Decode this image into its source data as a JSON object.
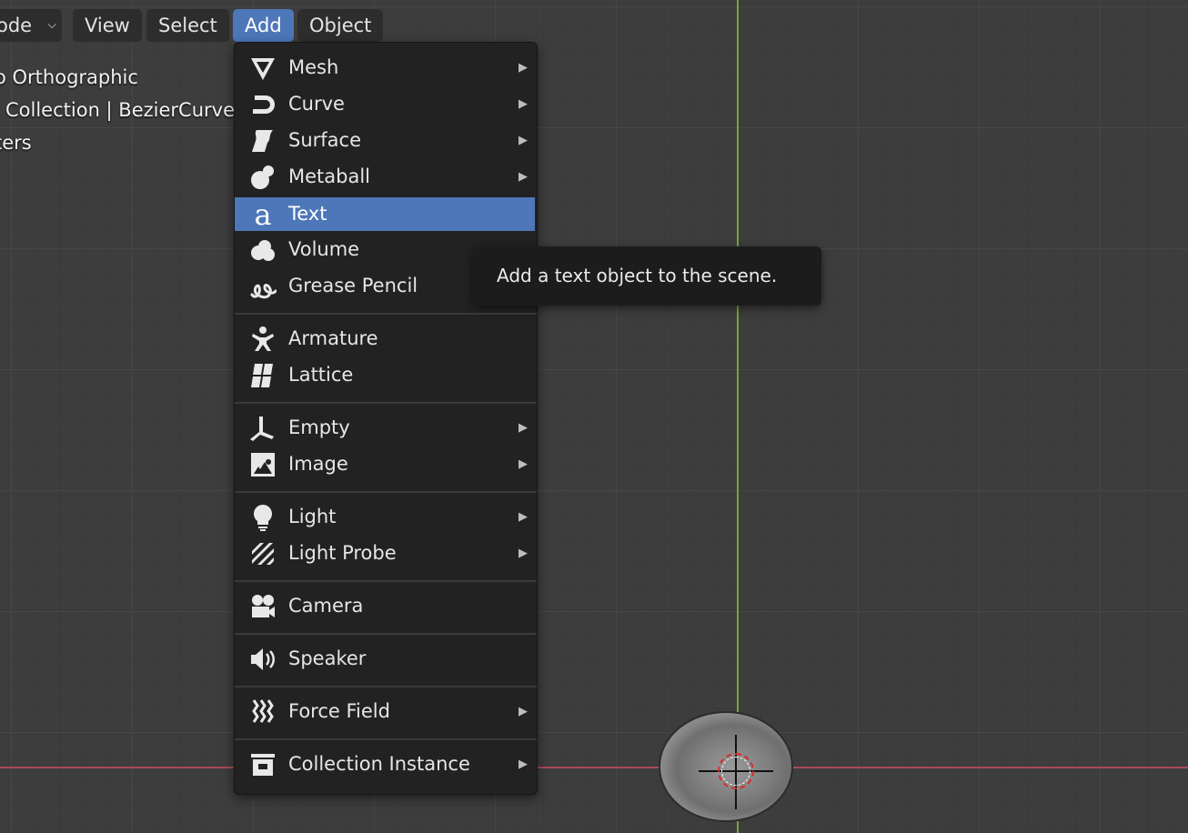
{
  "header": {
    "mode_label": "ode",
    "menus": [
      {
        "label": "View"
      },
      {
        "label": "Select"
      },
      {
        "label": "Add"
      },
      {
        "label": "Object"
      }
    ]
  },
  "overlay": {
    "line1": "o Orthographic",
    "line2": "Collection | BezierCurve",
    "line3": "ters"
  },
  "add_menu": {
    "items": [
      {
        "label": "Mesh",
        "icon": "mesh-icon",
        "submenu": true
      },
      {
        "label": "Curve",
        "icon": "curve-icon",
        "submenu": true
      },
      {
        "label": "Surface",
        "icon": "surface-icon",
        "submenu": true
      },
      {
        "label": "Metaball",
        "icon": "metaball-icon",
        "submenu": true
      },
      {
        "label": "Text",
        "icon": "text-icon",
        "submenu": false,
        "highlighted": true
      },
      {
        "label": "Volume",
        "icon": "volume-icon",
        "submenu": true
      },
      {
        "label": "Grease Pencil",
        "icon": "grease-pencil-icon",
        "submenu": false
      },
      {
        "label": "Armature",
        "icon": "armature-icon",
        "submenu": false
      },
      {
        "label": "Lattice",
        "icon": "lattice-icon",
        "submenu": false
      },
      {
        "label": "Empty",
        "icon": "empty-icon",
        "submenu": true
      },
      {
        "label": "Image",
        "icon": "image-icon",
        "submenu": true
      },
      {
        "label": "Light",
        "icon": "light-icon",
        "submenu": true
      },
      {
        "label": "Light Probe",
        "icon": "light-probe-icon",
        "submenu": true
      },
      {
        "label": "Camera",
        "icon": "camera-icon",
        "submenu": false
      },
      {
        "label": "Speaker",
        "icon": "speaker-icon",
        "submenu": false
      },
      {
        "label": "Force Field",
        "icon": "force-field-icon",
        "submenu": true
      },
      {
        "label": "Collection Instance",
        "icon": "collection-instance-icon",
        "submenu": true
      }
    ],
    "submenu_arrow": "▶"
  },
  "tooltip": {
    "text": "Add a text object to the scene."
  },
  "colors": {
    "accent": "#4d77b8",
    "menu_bg": "#222222",
    "viewport_bg": "#3d3d3d",
    "axis_x": "#a84a54",
    "axis_y": "#7aa43a"
  }
}
